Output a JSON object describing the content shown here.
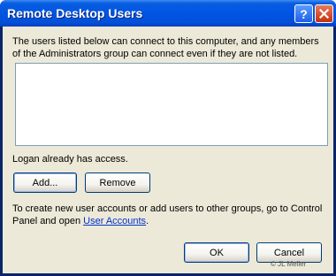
{
  "window": {
    "title": "Remote Desktop Users"
  },
  "intro_text": "The users listed below can connect to this computer, and any members of the Administrators group can connect even if they are not listed.",
  "users_list": [],
  "status_text": "Logan already has access.",
  "buttons": {
    "add": "Add...",
    "remove": "Remove",
    "ok": "OK",
    "cancel": "Cancel"
  },
  "info": {
    "line1": "To create new user accounts or add users to other groups, go to Control",
    "line2_prefix": "Panel and open ",
    "link": "User Accounts",
    "line2_suffix": "."
  },
  "copyright": "© JL Meller",
  "colors": {
    "titlebar": "#0054e3",
    "dialog_bg": "#ece9d8",
    "link": "#0033cc",
    "close_button": "#c6300c"
  },
  "icons": [
    "help-icon",
    "close-icon"
  ]
}
